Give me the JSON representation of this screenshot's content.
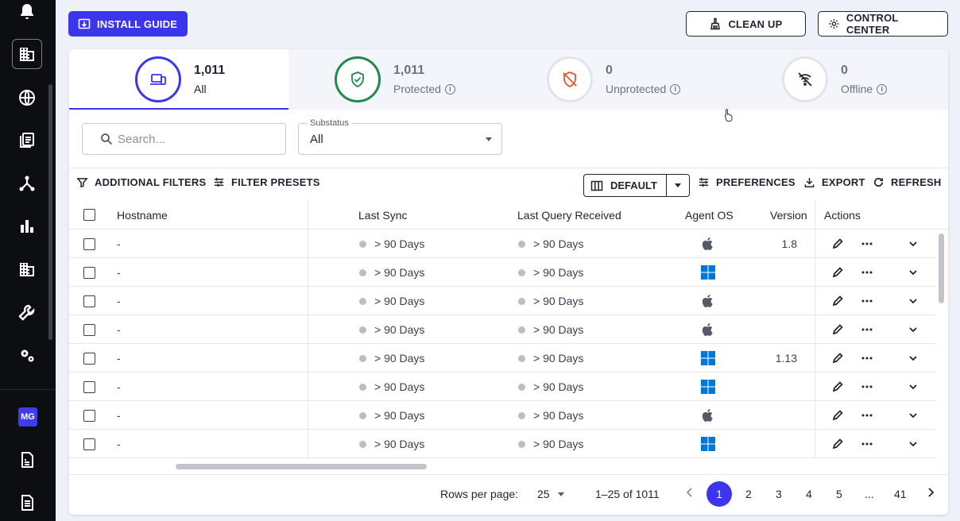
{
  "sidebar": {
    "icons": [
      "bell-icon",
      "building-icon",
      "globe-icon",
      "documents-icon",
      "network-icon",
      "bar-chart-icon",
      "office-building-icon",
      "wrench-icon",
      "gears-icon"
    ],
    "user_initials": "MG",
    "bottom_icons": [
      "report-icon",
      "notes-icon"
    ]
  },
  "header": {
    "install_guide": "INSTALL GUIDE",
    "clean_up": "CLEAN UP",
    "control_center": "CONTROL CENTER"
  },
  "stats": [
    {
      "value": "1,011",
      "label": "All",
      "color": "#3b35ee",
      "selected": true
    },
    {
      "value": "1,011",
      "label": "Protected",
      "color": "#1e8a4c"
    },
    {
      "value": "0",
      "label": "Unprotected",
      "color": "#e4572e"
    },
    {
      "value": "0",
      "label": "Offline",
      "color": "#1f2430"
    }
  ],
  "filters": {
    "search_placeholder": "Search...",
    "substatus_label": "Substatus",
    "substatus_value": "All"
  },
  "toolbar": {
    "additional_filters": "ADDITIONAL FILTERS",
    "filter_presets": "FILTER PRESETS",
    "view": "DEFAULT",
    "preferences": "PREFERENCES",
    "export": "EXPORT",
    "refresh": "REFRESH"
  },
  "table": {
    "columns": {
      "hostname": "Hostname",
      "last_sync": "Last Sync",
      "last_query": "Last Query Received",
      "agent_os": "Agent OS",
      "version": "Version",
      "actions": "Actions"
    },
    "rows": [
      {
        "hostname": "-",
        "last_sync": "> 90 Days",
        "last_query": "> 90 Days",
        "os": "apple",
        "version": "1.8"
      },
      {
        "hostname": "-",
        "last_sync": "> 90 Days",
        "last_query": "> 90 Days",
        "os": "windows",
        "version": ""
      },
      {
        "hostname": "-",
        "last_sync": "> 90 Days",
        "last_query": "> 90 Days",
        "os": "apple",
        "version": ""
      },
      {
        "hostname": "-",
        "last_sync": "> 90 Days",
        "last_query": "> 90 Days",
        "os": "apple",
        "version": ""
      },
      {
        "hostname": "-",
        "last_sync": "> 90 Days",
        "last_query": "> 90 Days",
        "os": "windows",
        "version": "1.13"
      },
      {
        "hostname": "-",
        "last_sync": "> 90 Days",
        "last_query": "> 90 Days",
        "os": "windows",
        "version": ""
      },
      {
        "hostname": "-",
        "last_sync": "> 90 Days",
        "last_query": "> 90 Days",
        "os": "apple",
        "version": ""
      },
      {
        "hostname": "-",
        "last_sync": "> 90 Days",
        "last_query": "> 90 Days",
        "os": "windows",
        "version": ""
      }
    ]
  },
  "pagination": {
    "rows_per_page_label": "Rows per page:",
    "rows_per_page": "25",
    "range": "1–25 of 1011",
    "pages": [
      "1",
      "2",
      "3",
      "4",
      "5",
      "...",
      "41"
    ],
    "current": "1"
  },
  "colors": {
    "accent": "#3b35ee",
    "windows": "#0078d4",
    "apple": "#555b66"
  }
}
